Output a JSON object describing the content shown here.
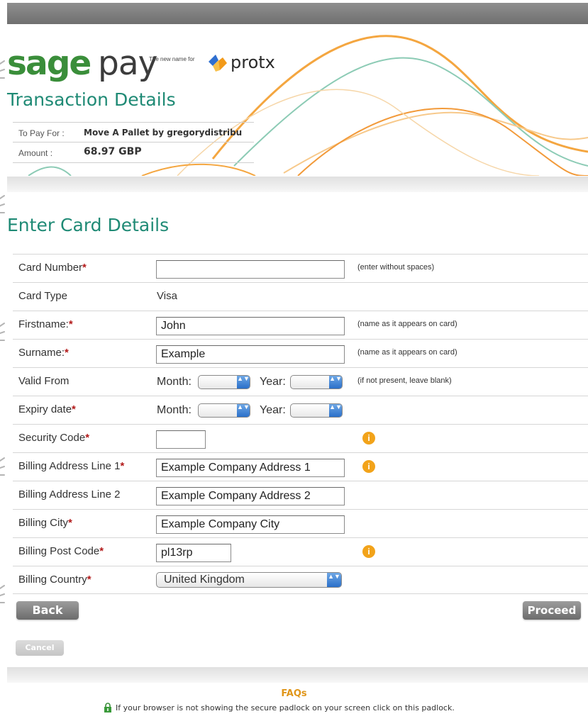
{
  "brand": {
    "logo_text_1": "sage",
    "logo_text_2": "pay",
    "tagline": "The new name for",
    "partner": "protx",
    "colors": {
      "green": "#3a8e3a",
      "teal": "#1f8a75",
      "orange": "#f2a31a"
    }
  },
  "transaction": {
    "title": "Transaction Details",
    "to_pay_for_label": "To Pay For :",
    "to_pay_for_value": "Move A Pallet by gregorydistribu",
    "amount_label": "Amount :",
    "amount_value": "68.97 GBP"
  },
  "card": {
    "title": "Enter Card Details",
    "card_number_label": "Card Number",
    "card_number_value": "",
    "card_number_hint": "(enter without spaces)",
    "card_type_label": "Card Type",
    "card_type_value": "Visa",
    "firstname_label": "Firstname:",
    "firstname_value": "John",
    "firstname_hint": "(name as it appears on card)",
    "surname_label": "Surname:",
    "surname_value": "Example",
    "surname_hint": "(name as it appears on card)",
    "valid_from_label": "Valid From",
    "valid_from_hint": "(if not present, leave blank)",
    "expiry_label": "Expiry date",
    "month_label": "Month:",
    "year_label": "Year:",
    "security_label": "Security Code",
    "security_value": "",
    "addr1_label": "Billing Address Line 1",
    "addr1_value": "Example Company Address 1",
    "addr2_label": "Billing Address Line 2",
    "addr2_value": "Example Company Address 2",
    "city_label": "Billing City",
    "city_value": "Example Company City",
    "postcode_label": "Billing Post Code",
    "postcode_value": "pl13rp",
    "country_label": "Billing Country",
    "country_value": "United Kingdom",
    "required_mark": "*",
    "info_icon_glyph": "i"
  },
  "buttons": {
    "back": "Back",
    "proceed": "Proceed",
    "cancel": "Cancel"
  },
  "footer": {
    "faqs": "FAQs",
    "padlock_text": "If your browser is not showing the secure padlock on your screen click on this padlock."
  },
  "icons": {
    "select_arrow": "▲▼",
    "info": "info-icon",
    "padlock": "padlock-icon"
  }
}
